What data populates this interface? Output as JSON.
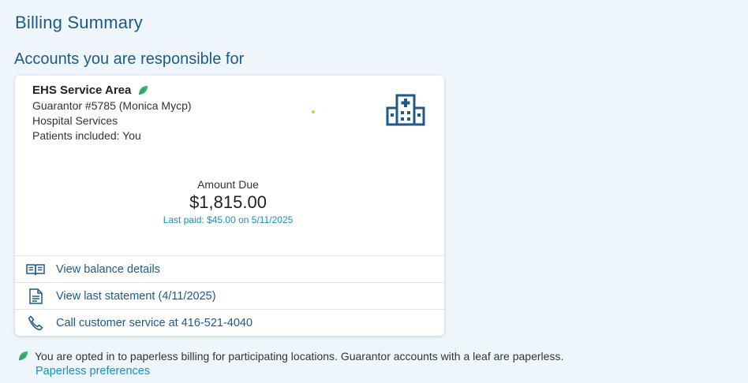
{
  "page": {
    "title": "Billing Summary",
    "section_title": "Accounts you are responsible for"
  },
  "account": {
    "name": "EHS Service Area",
    "guarantor": "Guarantor #5785 (Monica Mycp)",
    "service": "Hospital Services",
    "patients": "Patients included: You",
    "amount_label": "Amount Due",
    "amount_value": "$1,815.00",
    "last_paid": "Last paid: $45.00 on 5/11/2025"
  },
  "actions": [
    {
      "label": "View balance details",
      "icon": "book-icon"
    },
    {
      "label": "View last statement (4/11/2025)",
      "icon": "document-icon"
    },
    {
      "label": "Call customer service at 416-521-4040",
      "icon": "phone-icon"
    }
  ],
  "footer": {
    "note": "You are opted in to paperless billing for participating locations. Guarantor accounts with a leaf are paperless.",
    "link": "Paperless preferences"
  },
  "colors": {
    "heading": "#1d5a8a",
    "link": "#1a8ec4",
    "leaf": "#3bb273",
    "background": "#eef6fb"
  }
}
